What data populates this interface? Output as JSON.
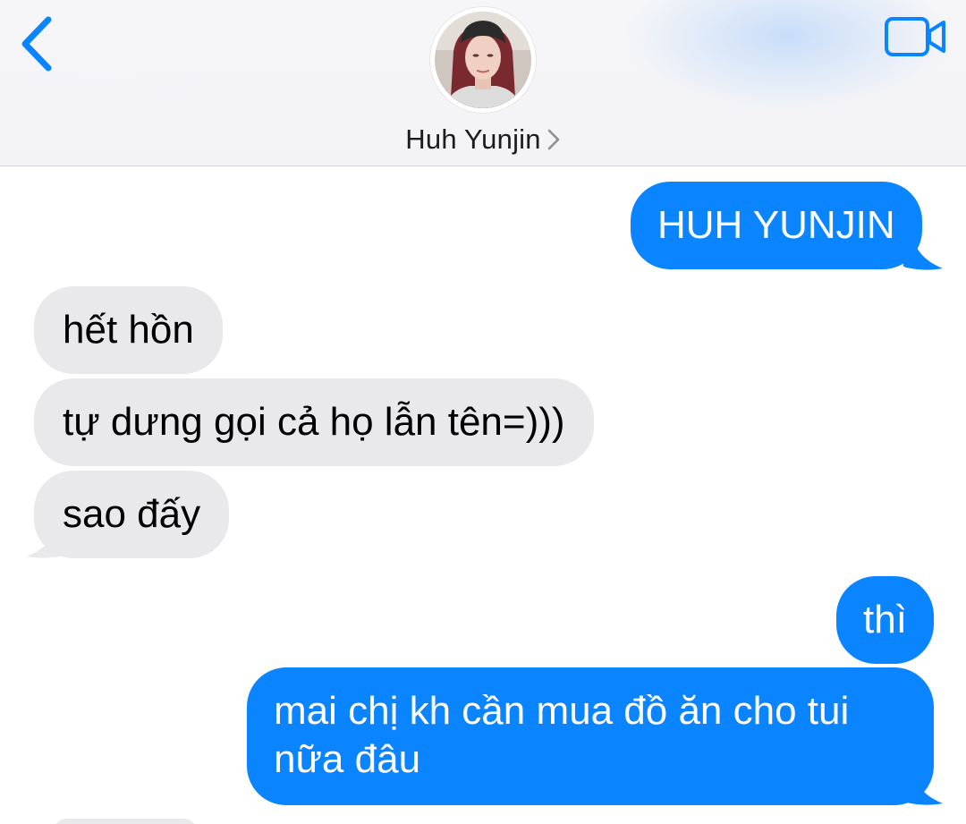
{
  "header": {
    "contact_name": "Huh Yunjin",
    "back_icon": "chevron-left-icon",
    "video_icon": "video-camera-icon",
    "accent_color": "#0a84ff"
  },
  "messages": [
    {
      "direction": "sent",
      "text": "HUH YUNJIN"
    },
    {
      "direction": "received",
      "text": "hết hồn"
    },
    {
      "direction": "received",
      "text": "tự dưng gọi cả họ lẫn tên=)))"
    },
    {
      "direction": "received",
      "text": "sao đấy"
    },
    {
      "direction": "sent",
      "text": "thì"
    },
    {
      "direction": "sent",
      "text": "mai chị kh cần mua đồ ăn cho tui nữa đâu"
    }
  ],
  "colors": {
    "sent_bubble": "#0a84ff",
    "received_bubble": "#e9e9eb"
  }
}
